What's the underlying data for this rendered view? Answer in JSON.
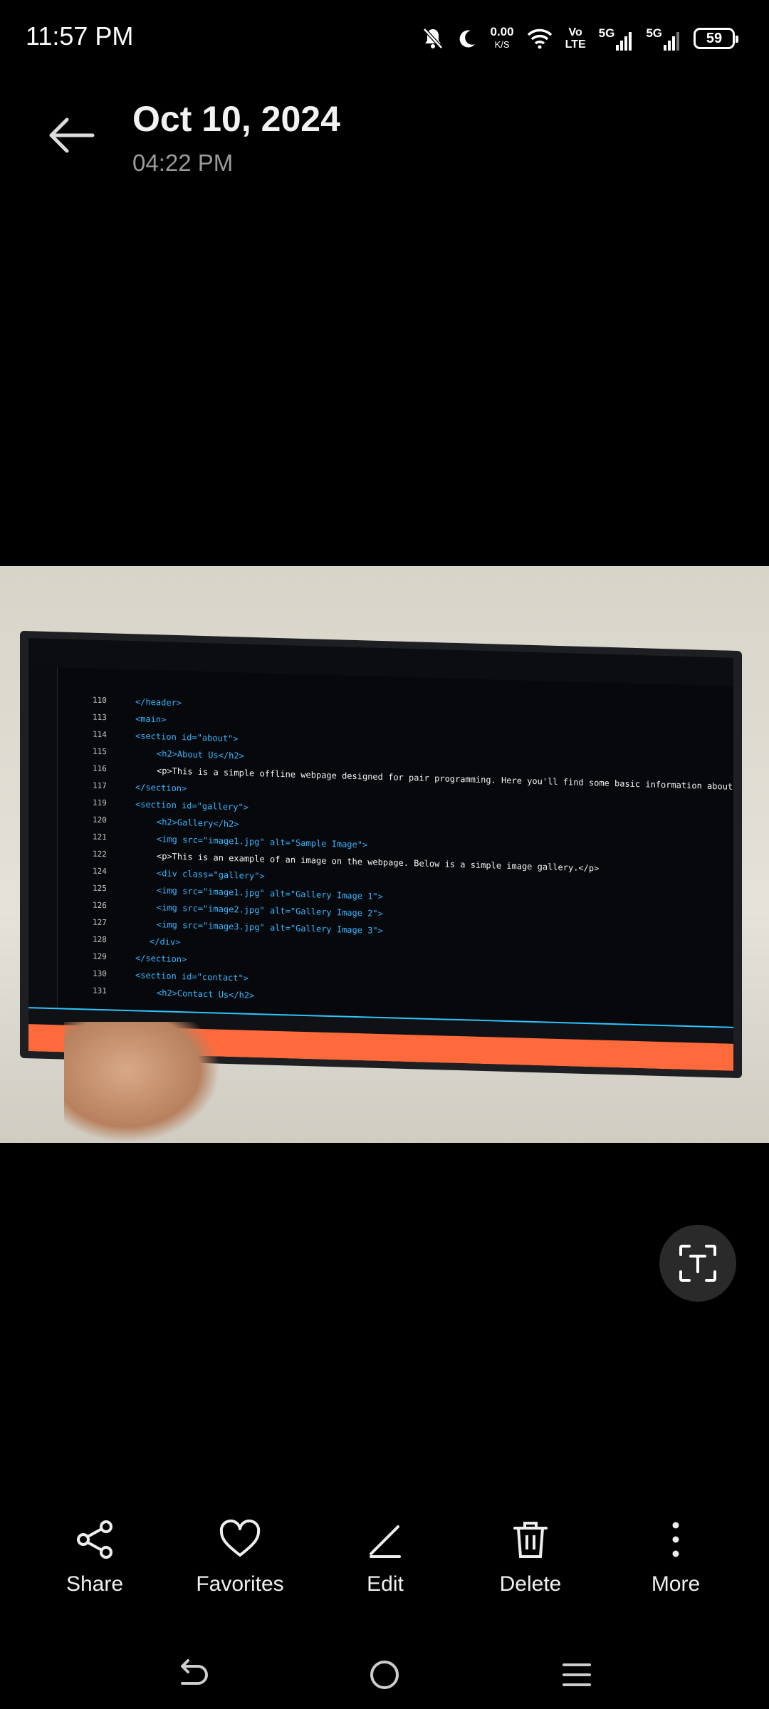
{
  "status_bar": {
    "time": "11:57 PM",
    "net_speed_value": "0.00",
    "net_speed_unit": "K/S",
    "volte_top": "Vo",
    "volte_bottom": "LTE",
    "network1": "5G",
    "network2": "5G",
    "battery": "59"
  },
  "header": {
    "date": "Oct 10, 2024",
    "time": "04:22 PM"
  },
  "photo": {
    "description_icon": "photo-viewer-image",
    "code_lines": [
      {
        "ln": "110",
        "html": "</header>"
      },
      {
        "ln": "113",
        "html": "<main>"
      },
      {
        "ln": "114",
        "html": "<section id=\"about\">"
      },
      {
        "ln": "115",
        "html": "<h2>About Us</h2>"
      },
      {
        "ln": "116",
        "html": "<p>This is a simple offline webpage designed for pair programming. Here you'll find some basic information about"
      },
      {
        "ln": "117",
        "html": "</section>"
      },
      {
        "ln": "119",
        "html": "<section id=\"gallery\">"
      },
      {
        "ln": "120",
        "html": "<h2>Gallery</h2>"
      },
      {
        "ln": "121",
        "html": "<img src=\"image1.jpg\" alt=\"Sample Image\">"
      },
      {
        "ln": "122",
        "html": "<p>This is an example of an image on the webpage. Below is a simple image gallery.</p>"
      },
      {
        "ln": "124",
        "html": "<div class=\"gallery\">"
      },
      {
        "ln": "125",
        "html": "<img src=\"image1.jpg\" alt=\"Gallery Image 1\">"
      },
      {
        "ln": "126",
        "html": "<img src=\"image2.jpg\" alt=\"Gallery Image 2\">"
      },
      {
        "ln": "127",
        "html": "<img src=\"image3.jpg\" alt=\"Gallery Image 3\">"
      },
      {
        "ln": "128",
        "html": "</div>"
      },
      {
        "ln": "129",
        "html": "</section>"
      },
      {
        "ln": "130",
        "html": "<section id=\"contact\">"
      },
      {
        "ln": "131",
        "html": "<h2>Contact Us</h2>"
      }
    ]
  },
  "actions": [
    {
      "label": "Share",
      "icon": "share-icon"
    },
    {
      "label": "Favorites",
      "icon": "heart-icon"
    },
    {
      "label": "Edit",
      "icon": "edit-icon"
    },
    {
      "label": "Delete",
      "icon": "trash-icon"
    },
    {
      "label": "More",
      "icon": "more-vertical-icon"
    }
  ],
  "colors": {
    "background": "#000000",
    "text_primary": "#f2f2f2",
    "text_secondary": "#9a9a9a",
    "scan_button_bg": "#2a2a2a"
  }
}
